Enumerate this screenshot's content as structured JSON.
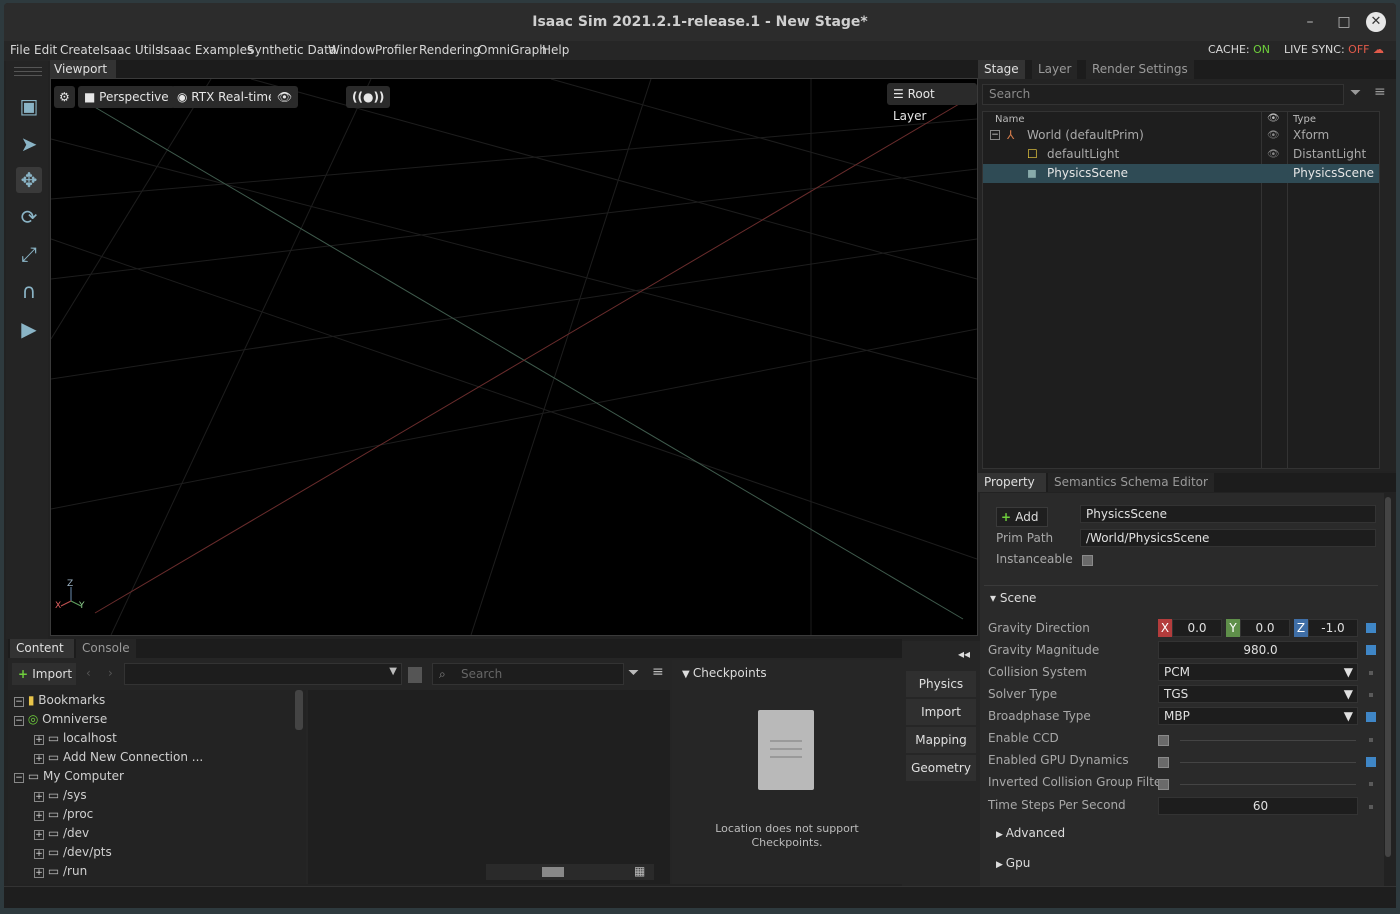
{
  "window": {
    "title": "Isaac Sim 2021.2.1-release.1 - New Stage*",
    "minimize_glyph": "–",
    "maximize_glyph": "□",
    "close_glyph": "✕"
  },
  "menu": [
    "File",
    "Edit",
    "Create",
    "Isaac Utils",
    "Isaac Examples",
    "Synthetic Data",
    "Window",
    "Profiler",
    "Rendering",
    "OmniGraph",
    "Help"
  ],
  "status": {
    "cache_label": "CACHE:",
    "cache_value": "ON",
    "sync_label": "LIVE SYNC:",
    "sync_value": "OFF"
  },
  "viewport": {
    "tab": "Viewport",
    "camera": "Perspective",
    "renderer": "RTX Real-time",
    "layer": "Root Layer",
    "axis_x": "X",
    "axis_y": "Y",
    "axis_z": "Z"
  },
  "stage": {
    "tabs": [
      "Stage",
      "Layer",
      "Render Settings"
    ],
    "search_placeholder": "Search",
    "col_name": "Name",
    "col_type": "Type",
    "rows": [
      {
        "name": "World (defaultPrim)",
        "type": "Xform"
      },
      {
        "name": "defaultLight",
        "type": "DistantLight"
      },
      {
        "name": "PhysicsScene",
        "type": "PhysicsScene"
      }
    ]
  },
  "property": {
    "tabs": [
      "Property",
      "Semantics Schema Editor"
    ],
    "add_label": "Add",
    "prim_name": "PhysicsScene",
    "prim_path_label": "Prim Path",
    "prim_path": "/World/PhysicsScene",
    "instanceable_label": "Instanceable",
    "scene_section": "Scene",
    "gravity_direction_label": "Gravity Direction",
    "gravity_x": "0.0",
    "gravity_y": "0.0",
    "gravity_z": "-1.0",
    "gravity_magnitude_label": "Gravity Magnitude",
    "gravity_magnitude": "980.0",
    "collision_system_label": "Collision System",
    "collision_system": "PCM",
    "solver_type_label": "Solver Type",
    "solver_type": "TGS",
    "broadphase_label": "Broadphase Type",
    "broadphase": "MBP",
    "enable_ccd_label": "Enable CCD",
    "gpu_dynamics_label": "Enabled GPU Dynamics",
    "inverted_filter_label": "Inverted Collision Group Filter",
    "timesteps_label": "Time Steps Per Second",
    "timesteps": "60",
    "advanced_section": "Advanced",
    "gpu_section": "Gpu"
  },
  "content": {
    "tabs": [
      "Content",
      "Console"
    ],
    "import_label": "Import",
    "search_placeholder": "Search",
    "tree": [
      {
        "label": "Bookmarks",
        "depth": 0
      },
      {
        "label": "Omniverse",
        "depth": 0
      },
      {
        "label": "localhost",
        "depth": 1
      },
      {
        "label": "Add New Connection ...",
        "depth": 1
      },
      {
        "label": "My Computer",
        "depth": 0
      },
      {
        "label": "/sys",
        "depth": 1
      },
      {
        "label": "/proc",
        "depth": 1
      },
      {
        "label": "/dev",
        "depth": 1
      },
      {
        "label": "/dev/pts",
        "depth": 1
      },
      {
        "label": "/run",
        "depth": 1
      }
    ],
    "checkpoints_title": "Checkpoints",
    "checkpoints_msg_1": "Location does not support",
    "checkpoints_msg_2": "Checkpoints."
  },
  "side_buttons": [
    "Physics",
    "Import",
    "Mapping",
    "Geometry"
  ],
  "colors": {
    "accent_blue": "#3f86c6",
    "cache_on": "#6fcf3c",
    "sync_off": "#e05a4a",
    "selection": "#2f4b55"
  }
}
